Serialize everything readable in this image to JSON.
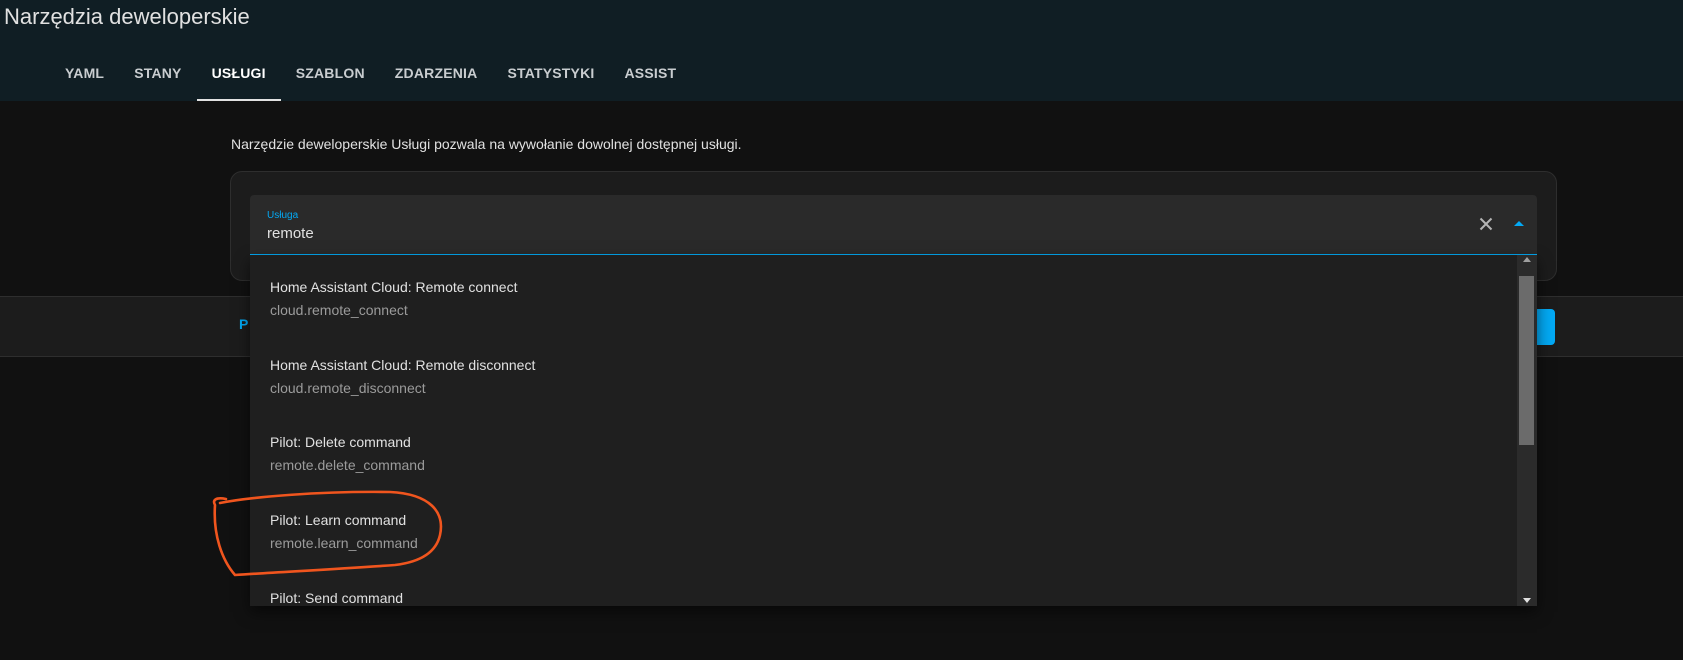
{
  "header": {
    "title": "Narzędzia deweloperskie",
    "tabs": [
      {
        "label": "YAML"
      },
      {
        "label": "STANY"
      },
      {
        "label": "USŁUGI"
      },
      {
        "label": "SZABLON"
      },
      {
        "label": "ZDARZENIA"
      },
      {
        "label": "STATYSTYKI"
      },
      {
        "label": "ASSIST"
      }
    ],
    "active_tab": "USŁUGI"
  },
  "main": {
    "description": "Narzędzie deweloperskie Usługi pozwala na wywołanie dowolnej dostępnej usługi.",
    "service_field": {
      "label": "Usługa",
      "value": "remote"
    },
    "bottom_bar": {
      "left_link_partial": "P"
    }
  },
  "dropdown": {
    "options": [
      {
        "title": "Home Assistant Cloud: Remote connect",
        "service": "cloud.remote_connect"
      },
      {
        "title": "Home Assistant Cloud: Remote disconnect",
        "service": "cloud.remote_disconnect"
      },
      {
        "title": "Pilot: Delete command",
        "service": "remote.delete_command"
      },
      {
        "title": "Pilot: Learn command",
        "service": "remote.learn_command"
      },
      {
        "title": "Pilot: Send command",
        "service": ""
      }
    ],
    "highlighted_option": "remote.learn_command"
  },
  "icons": {
    "clear": "close-icon",
    "expand": "chevron-up-icon"
  },
  "colors": {
    "accent": "#03a9f4",
    "header_bg": "#101e24",
    "annotation": "#f0551e"
  }
}
